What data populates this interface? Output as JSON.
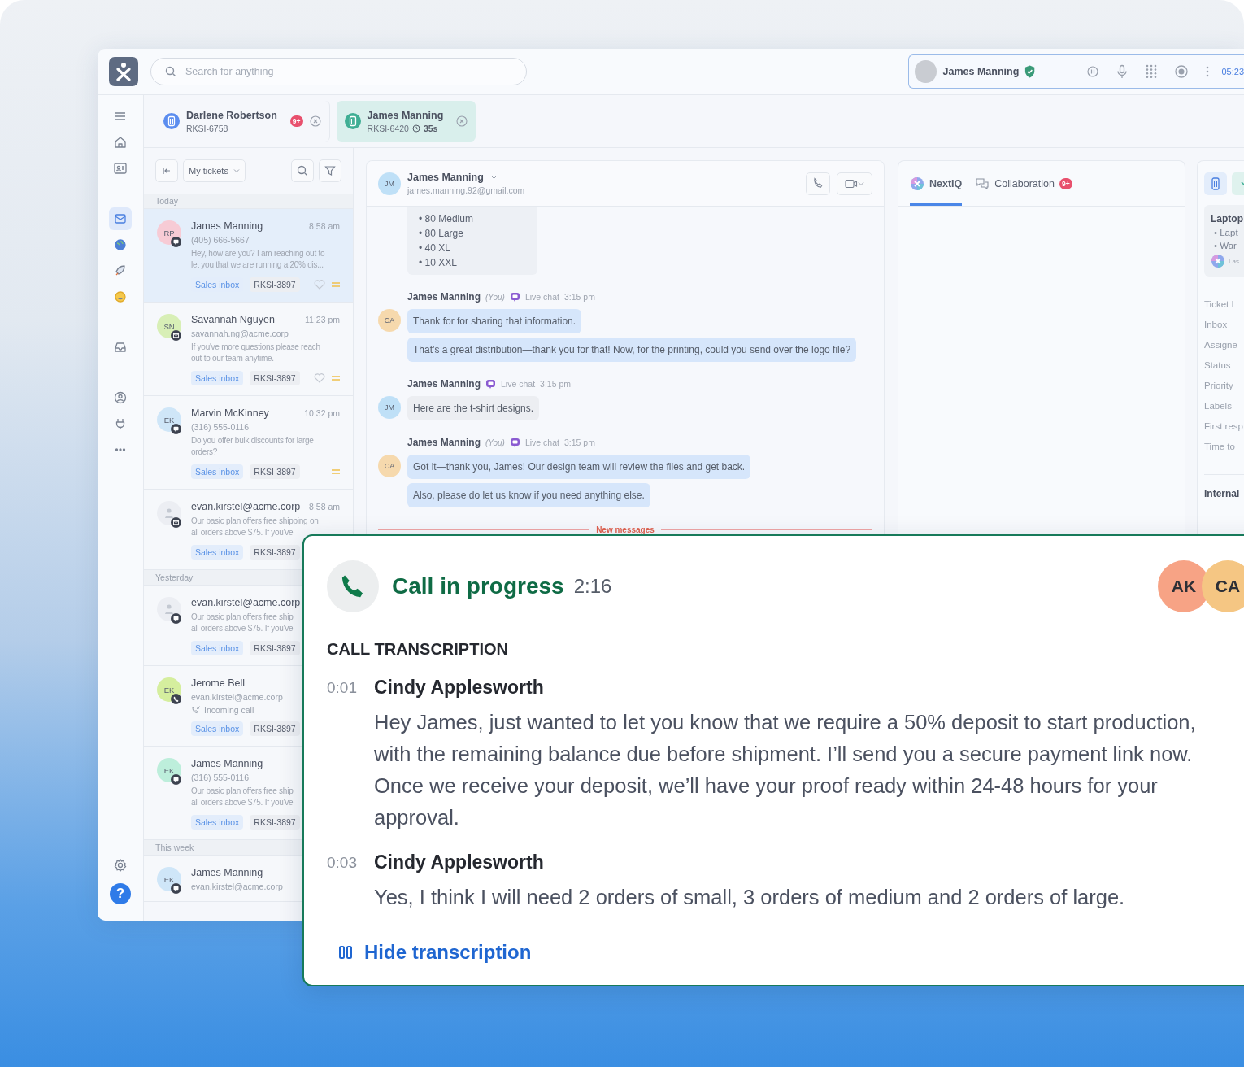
{
  "search": {
    "placeholder": "Search for anything"
  },
  "call_widget": {
    "name": "James Manning",
    "verified": true,
    "timer": "05:23"
  },
  "rail": [
    {
      "selected": false
    },
    {
      "selected": false
    },
    {
      "selected": false
    },
    {
      "selected": true
    },
    {
      "selected": false
    },
    {
      "selected": false
    },
    {
      "selected": false
    },
    {
      "selected": false
    },
    {
      "selected": false
    },
    {
      "selected": false
    },
    {
      "selected": false
    }
  ],
  "rail_bottom": {
    "help_label": "?"
  },
  "open_tabs": [
    {
      "name": "Darlene Robertson",
      "ticket": "RKSI-6758",
      "badge": "9+",
      "color": "#5b8def",
      "selected": false
    },
    {
      "name": "James Manning",
      "ticket": "RKSI-6420",
      "timer": "35s",
      "color": "#3fae94",
      "selected": true
    }
  ],
  "ticket_list": {
    "filter": "My tickets",
    "groups": [
      {
        "label": "Today",
        "tickets": [
          {
            "name": "James Manning",
            "time": "8:58 am",
            "contact": "(405) 666-5667",
            "preview": [
              "Hey, how are you? I am reaching out to",
              "let you that we are running a 20% dis..."
            ],
            "inbox": "Sales inbox",
            "ticket": "RKSI-3897",
            "initials": "RP",
            "color": "#f7cbd5",
            "kind": "chat",
            "favorite": false,
            "flagged": true,
            "selected": true
          },
          {
            "name": "Savannah Nguyen",
            "time": "11:23 pm",
            "contact": "savannah.ng@acme.corp",
            "preview": [
              "If you've more questions please reach",
              "out to our team anytime."
            ],
            "inbox": "Sales inbox",
            "ticket": "RKSI-3897",
            "initials": "SN",
            "color": "#d8efb6",
            "kind": "email",
            "favorite": false,
            "flagged": true,
            "selected": false
          },
          {
            "name": "Marvin McKinney",
            "time": "10:32 pm",
            "contact": "(316) 555-0116",
            "preview": [
              "Do you offer bulk discounts for large",
              "orders?"
            ],
            "inbox": "Sales inbox",
            "ticket": "RKSI-3897",
            "initials": "EK",
            "color": "#cfe6f8",
            "kind": "chat",
            "flagged": true,
            "selected": false
          },
          {
            "name": "evan.kirstel@acme.corp",
            "time": "8:58 am",
            "preview": [
              "Our basic plan offers free shipping on",
              "all orders above $75. If you've"
            ],
            "inbox": "Sales inbox",
            "ticket": "RKSI-3897",
            "color": "#eceef3",
            "kind": "email",
            "selected": false
          }
        ]
      },
      {
        "label": "Yesterday",
        "tickets": [
          {
            "name": "evan.kirstel@acme.corp",
            "preview": [
              "Our basic plan offers free ship",
              "all orders above $75. If you've"
            ],
            "inbox": "Sales inbox",
            "ticket": "RKSI-3897",
            "color": "#eceef3",
            "kind": "chat",
            "selected": false
          },
          {
            "name": "Jerome Bell",
            "contact": "evan.kirstel@acme.corp",
            "activity": "Incoming call",
            "inbox": "Sales inbox",
            "ticket": "RKSI-3897",
            "initials": "EK",
            "color": "#d5ee9e",
            "kind": "call",
            "selected": false
          },
          {
            "name": "James Manning",
            "contact": "(316) 555-0116",
            "preview": [
              "Our basic plan offers free ship",
              "all orders above $75. If you've"
            ],
            "inbox": "Sales inbox",
            "ticket": "RKSI-3897",
            "initials": "EK",
            "color": "#bdeedb",
            "kind": "chat",
            "selected": false
          }
        ]
      },
      {
        "label": "This week",
        "tickets": [
          {
            "name": "James Manning",
            "contact": "evan.kirstel@acme.corp",
            "initials": "EK",
            "color": "#cfe6f8",
            "kind": "chat",
            "selected": false
          }
        ]
      }
    ]
  },
  "conversation": {
    "name": "James Manning",
    "email": "james.manning.92@gmail.com",
    "initials": "JM",
    "color": "#bfe0f7",
    "list_bubble": [
      "• 80 Medium",
      "• 80 Large",
      "• 40 XL",
      "• 10 XXL"
    ],
    "groups": [
      {
        "sender": "James Manning",
        "you_label": "(You)",
        "channel": "Live chat",
        "time": "3:15 pm",
        "initials": "CA",
        "color": "#f6d9ad",
        "you": true,
        "bubbles": [
          "Thank for for sharing that information.",
          "That’s a great distribution—thank you for that! Now, for the printing, could you send over the logo file?"
        ]
      },
      {
        "sender": "James Manning",
        "channel": "Live chat",
        "time": "3:15 pm",
        "initials": "JM",
        "color": "#bfe0f7",
        "you": false,
        "bubbles": [
          "Here are the t-shirt designs."
        ]
      },
      {
        "sender": "James Manning",
        "you_label": "(You)",
        "channel": "Live chat",
        "time": "3:15 pm",
        "initials": "CA",
        "color": "#f6d9ad",
        "you": true,
        "bubbles": [
          "Got it—thank you, James! Our design team will review the files and get back.",
          "Also, please do let us know if you need anything else."
        ]
      }
    ],
    "divider": "New messages"
  },
  "assistant_panel": {
    "tabs": [
      {
        "label": "NextIQ",
        "selected": true
      },
      {
        "label": "Collaboration",
        "badge": "9+",
        "selected": false
      }
    ]
  },
  "details_panel": {
    "card_title": "Laptop",
    "card_bullets": [
      "• Lapt",
      "• War"
    ],
    "card_note": "Las",
    "fields": [
      "Ticket I",
      "Inbox",
      "Assigne",
      "Status",
      "Priority",
      "Labels",
      "First resp",
      "Time to"
    ],
    "section": "Internal"
  },
  "call": {
    "title": "Call in progress",
    "duration": "2:16",
    "participants": [
      {
        "initials": "AK",
        "color": "#f7a385"
      },
      {
        "initials": "CA",
        "color": "#f5c683"
      }
    ],
    "heading": "CALL TRANSCRIPTION",
    "entries": [
      {
        "time": "0:01",
        "speaker": "Cindy Applesworth",
        "text": "Hey James, just wanted to let you know that we require a 50% deposit to start production, with the remaining balance due before shipment. I’ll send you a secure payment link now. Once we receive your deposit, we’ll have your proof ready within 24-48 hours for your approval."
      },
      {
        "time": "0:03",
        "speaker": "Cindy Applesworth",
        "text": "Yes, I think I will need 2 orders of small, 3 orders of medium and 2 orders of large."
      }
    ],
    "toggle": "Hide transcription"
  }
}
